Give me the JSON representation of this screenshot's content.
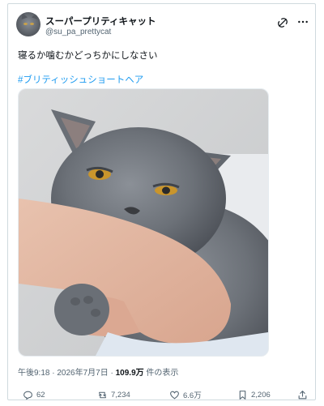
{
  "post": {
    "display_name": "スーパープリティキャット",
    "handle": "@su_pa_prettycat",
    "text": "寝るか噛むかどっちかにしなさい",
    "hashtag": "#ブリティッシュショートヘア",
    "meta": {
      "time": "午後9:18",
      "sep1": " · ",
      "date": "2026年7月7日",
      "sep2": " · ",
      "views": "109.9万",
      "views_suffix": " 件の表示"
    }
  },
  "actions": {
    "replies": "62",
    "reposts": "7,234",
    "likes": "6.6万",
    "bookmarks": "2,206"
  },
  "icons": {
    "grok": "grok-icon",
    "more": "more-icon",
    "reply": "reply-icon",
    "repost": "repost-icon",
    "like": "heart-icon",
    "bookmark": "bookmark-icon",
    "share": "share-icon"
  },
  "colors": {
    "link": "#1d9bf0",
    "muted": "#536471",
    "text": "#0f1419",
    "border": "#cfd9de"
  }
}
